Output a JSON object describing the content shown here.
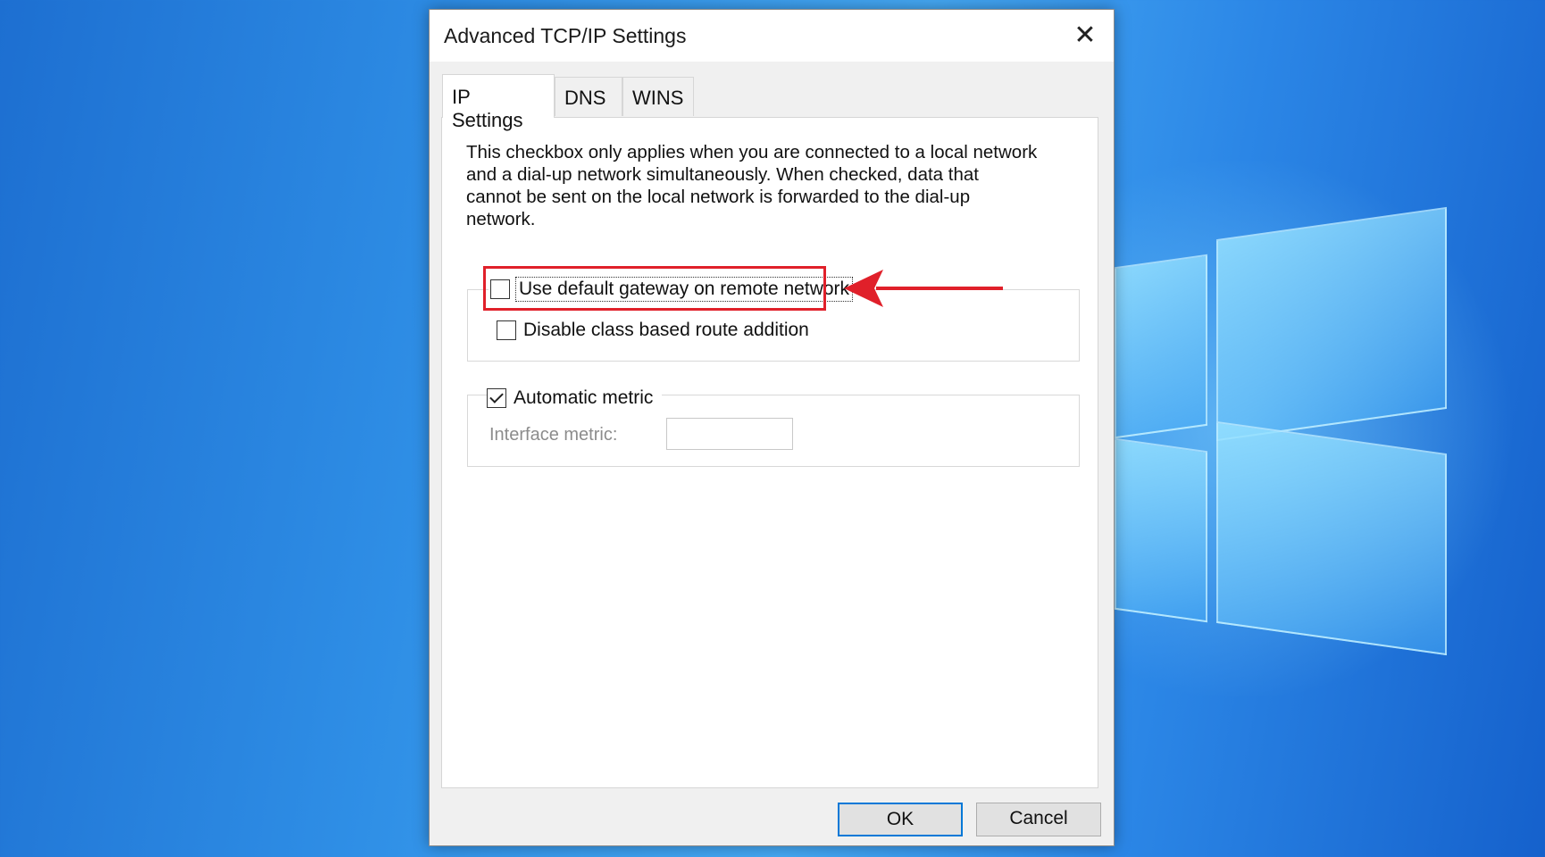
{
  "dialog": {
    "title": "Advanced TCP/IP Settings",
    "close_icon": "close-icon"
  },
  "tabs": [
    {
      "label": "IP Settings",
      "active": true
    },
    {
      "label": "DNS",
      "active": false
    },
    {
      "label": "WINS",
      "active": false
    }
  ],
  "description": "This checkbox only applies when you are connected to a local network and a dial-up network simultaneously.  When checked, data that cannot be sent on the local network is forwarded to the dial-up network.",
  "options": {
    "use_default_gateway": {
      "label": "Use default gateway on remote network",
      "checked": false
    },
    "disable_class_route": {
      "label": "Disable class based route addition",
      "checked": false
    },
    "automatic_metric": {
      "label": "Automatic metric",
      "checked": true
    }
  },
  "interface_metric": {
    "label": "Interface metric:",
    "value": ""
  },
  "buttons": {
    "ok": "OK",
    "cancel": "Cancel"
  },
  "annotation": {
    "highlight_color": "#e0202a",
    "arrow_icon": "red-arrow-left-icon"
  },
  "colors": {
    "accent": "#0078d7",
    "desktop_blue": "#2f8fe6"
  }
}
